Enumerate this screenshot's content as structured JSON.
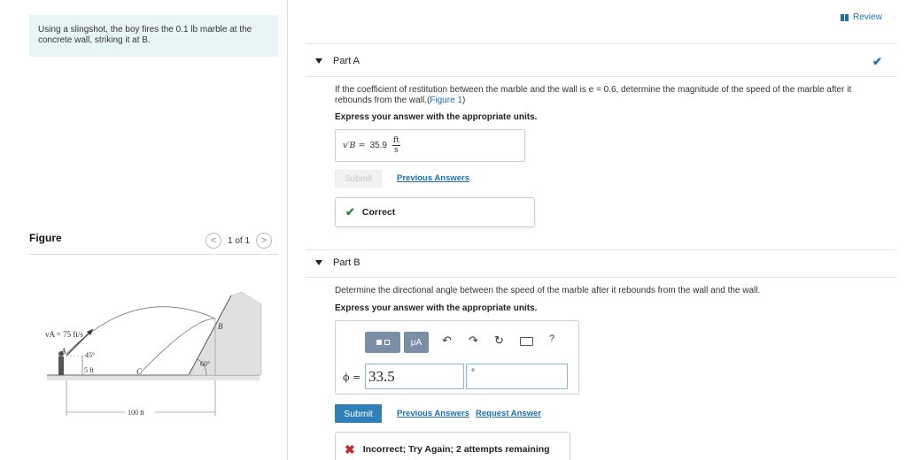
{
  "problem": {
    "text_line1": "Using a slingshot, the boy fires the 0.1 lb marble at the",
    "text_line2": "concrete wall, striking it at B."
  },
  "figure": {
    "title": "Figure",
    "counter": "1 of 1",
    "prev_glyph": "<",
    "next_glyph": ">",
    "labels": {
      "velocity": "vA = 75 ft/s",
      "point_a": "A",
      "point_b": "B",
      "point_c": "C",
      "angle_launch": "45°",
      "angle_wall": "60°",
      "height": "5 ft",
      "distance": "100 ft"
    }
  },
  "review": {
    "label": "Review"
  },
  "part_a": {
    "title": "Part A",
    "question_line1": "If the coefficient of restitution between the marble and the wall is e = 0.6, determine the magnitude of the speed of the marble after it",
    "question_line2_pre": "rebounds from the wall.(",
    "figure_link": "Figure 1",
    "question_line2_post": ")",
    "instruction": "Express your answer with the appropriate units.",
    "answer_label": "v′B =",
    "answer_value": "35.9",
    "answer_unit_num": "ft",
    "answer_unit_den": "s",
    "submit_label": "Submit",
    "previous_answers": "Previous Answers",
    "feedback": "Correct",
    "status_icon": "check-icon"
  },
  "part_b": {
    "title": "Part B",
    "question": "Determine the directional angle between the speed of the marble after it rebounds from the wall and the wall.",
    "instruction": "Express your answer with the appropriate units.",
    "toolbar": {
      "units_label": "μA",
      "undo": "↶",
      "redo": "↷",
      "reset": "↻",
      "help": "?"
    },
    "answer_label": "ϕ =",
    "answer_value": "33.5",
    "unit_value": "°",
    "submit_label": "Submit",
    "previous_answers": "Previous Answers",
    "request_answer": "Request Answer",
    "feedback": "Incorrect; Try Again; 2 attempts remaining"
  },
  "colors": {
    "accent": "#1a6fb5",
    "correct": "#2e8b3a",
    "incorrect": "#c62828",
    "problem_bg": "#e8f5f7"
  }
}
